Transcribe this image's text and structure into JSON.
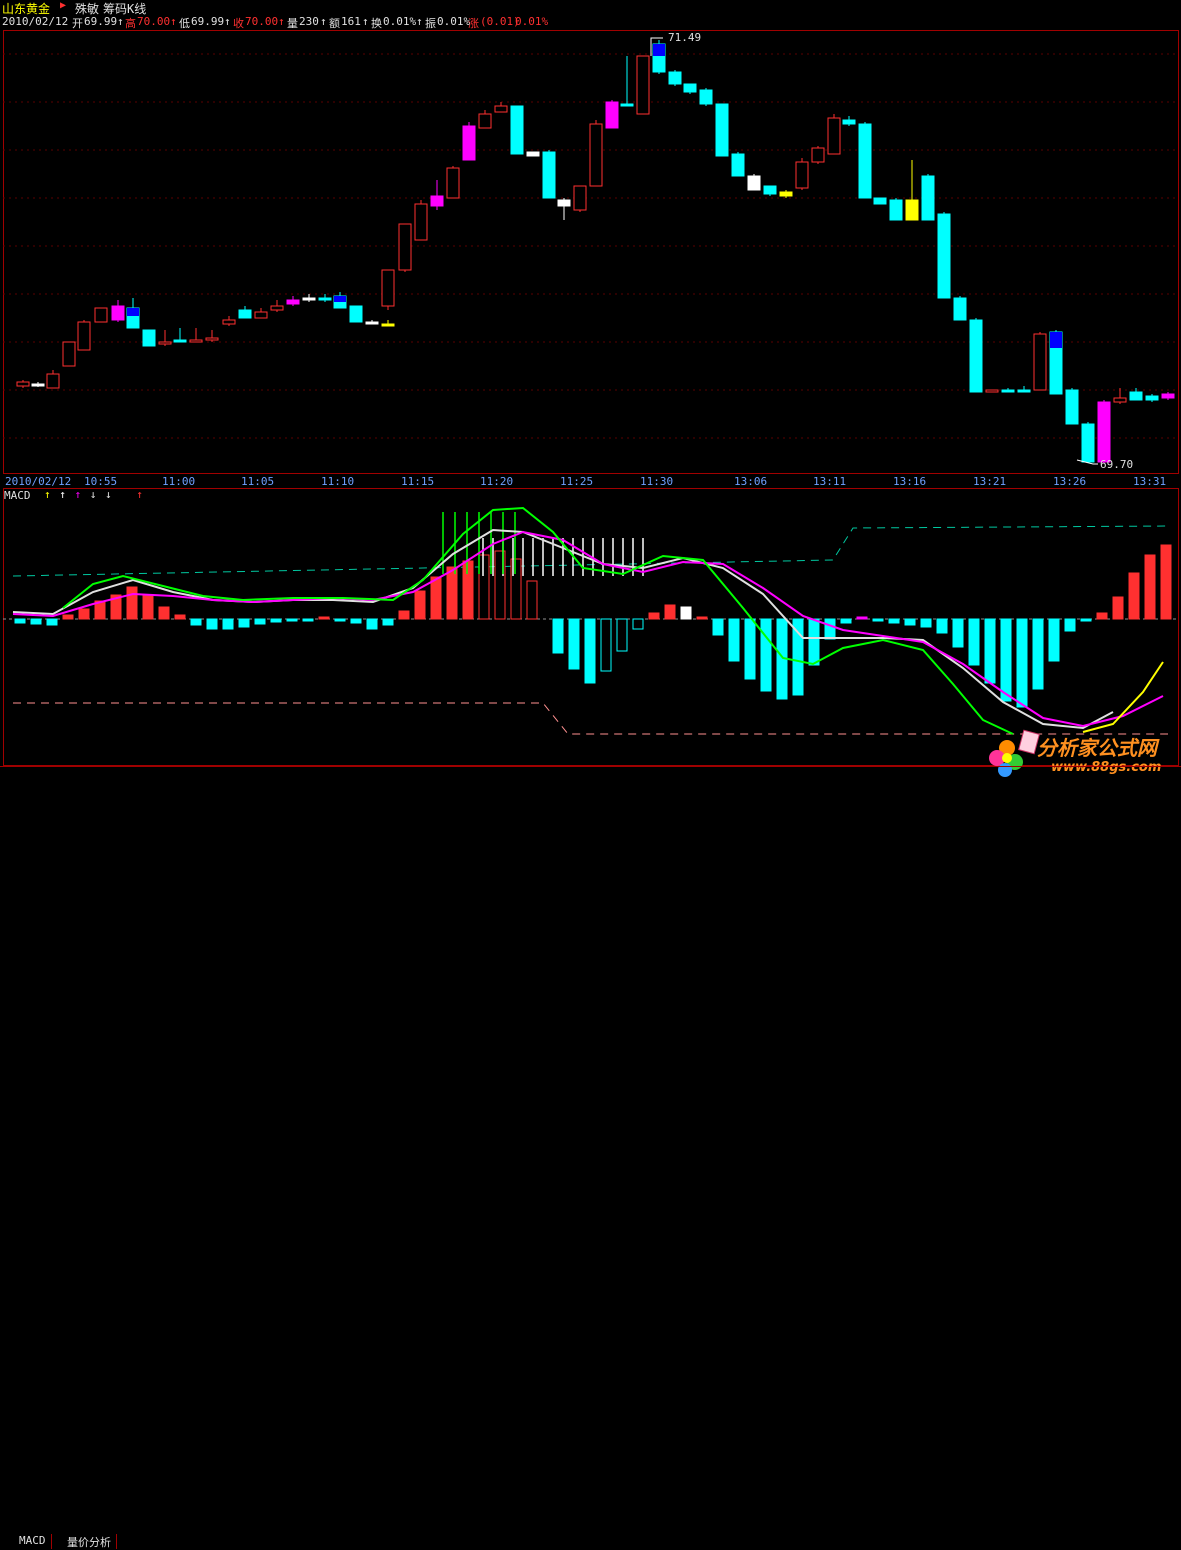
{
  "header": {
    "stock_name": "山东黄金",
    "menu_items": [
      "殊敏",
      "筹码K线"
    ]
  },
  "quote": {
    "date": "2010/02/12",
    "open_label": "开",
    "open": "69.99",
    "high_label": "高",
    "high": "70.00",
    "low_label": "低",
    "low": "69.99",
    "close_label": "收",
    "close": "70.00",
    "volume_label": "量",
    "volume": "230",
    "amount_label": "额",
    "amount": "161",
    "turnover_label": "换",
    "turnover": "0.01%",
    "amplitude_label": "振",
    "amplitude": "0.01%",
    "change_label": "涨",
    "change": "(0.01)",
    "change_pct": "0.01%"
  },
  "main_chart": {
    "high_annotation": "71.49",
    "low_annotation": "69.70"
  },
  "time_axis": {
    "date": "2010/02/12",
    "ticks": [
      "10:55",
      "11:00",
      "11:05",
      "11:10",
      "11:15",
      "11:20",
      "11:25",
      "11:30",
      "13:06",
      "13:11",
      "13:16",
      "13:21",
      "13:26",
      "13:31"
    ]
  },
  "macd_panel": {
    "title": "MACD",
    "signal_arrows": [
      "↑",
      "↑",
      "↑",
      "↓",
      "↓",
      "↑"
    ]
  },
  "footer": {
    "tabs": [
      "MACD",
      "量价分析"
    ]
  },
  "watermark": {
    "brand": "分析家公式网",
    "url": "www.88gs.com"
  },
  "colors": {
    "up": "#ff3030",
    "down": "#00ffff",
    "axis": "#a00000",
    "macd_dif": "#ffffff",
    "macd_dea": "#ff00ff",
    "accent_green": "#00ff00",
    "accent_yellow": "#ffff00"
  }
}
